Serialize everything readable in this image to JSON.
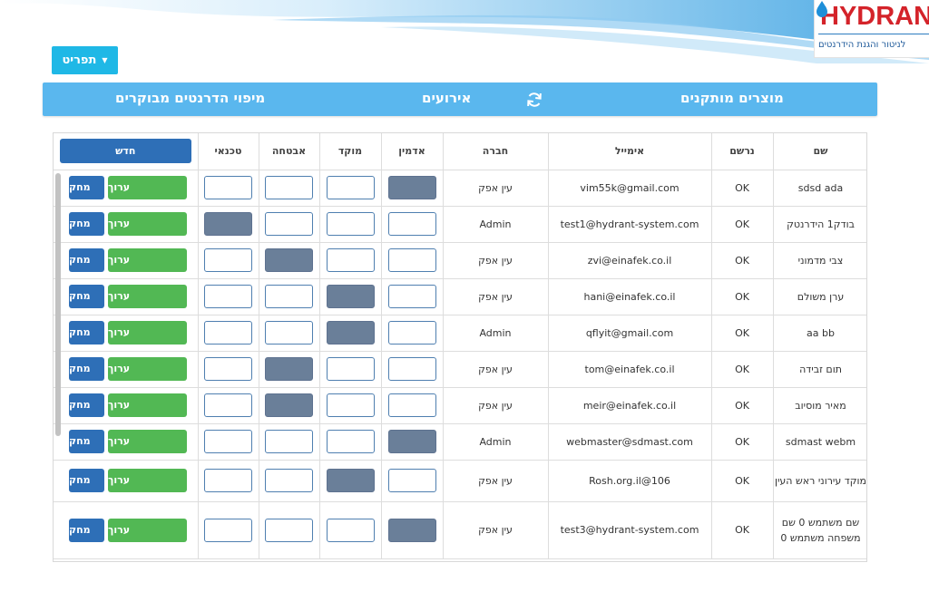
{
  "brand": {
    "logo_text": "HYDRANT",
    "tagline": "לניטור והגנת הידרנטים",
    "colors": {
      "logo_red": "#d4232a",
      "banner_blue": "#4aa9e4",
      "nav_blue": "#5ab7ee",
      "menu_cyan": "#1fb8e6"
    }
  },
  "menu_button": {
    "label": "תפריט",
    "icon": "caret-down-icon"
  },
  "nav": {
    "installed_products": "מוצרים מותקנים",
    "events": "אירועים",
    "refresh_icon": "refresh-icon",
    "hydrant_map": "מיפוי הדרנטים מבוקרים"
  },
  "table": {
    "headers": {
      "name": "שם",
      "registered": "נרשם",
      "email": "אימייל",
      "company": "חברה",
      "admin": "אדמין",
      "hub": "מוקד",
      "security": "אבטחה",
      "technician": "טכנאי",
      "new_button": "חדש"
    },
    "edit_label": "ערוך",
    "delete_label": "מחק",
    "rows": [
      {
        "name": "sdsd ada",
        "registered": "OK",
        "email": "vim55k@gmail.com",
        "company": "עין אפק",
        "admin": true,
        "hub": false,
        "security": false,
        "technician": false
      },
      {
        "name": "בודק1 הידרנטק",
        "registered": "OK",
        "email": "test1@hydrant-system.com",
        "company": "Admin",
        "admin": false,
        "hub": false,
        "security": false,
        "technician": true
      },
      {
        "name": "צבי מדמוני",
        "registered": "OK",
        "email": "zvi@einafek.co.il",
        "company": "עין אפק",
        "admin": false,
        "hub": false,
        "security": true,
        "technician": false
      },
      {
        "name": "ערן משולם",
        "registered": "OK",
        "email": "hani@einafek.co.il",
        "company": "עין אפק",
        "admin": false,
        "hub": true,
        "security": false,
        "technician": false
      },
      {
        "name": "aa bb",
        "registered": "OK",
        "email": "qflyit@gmail.com",
        "company": "Admin",
        "admin": false,
        "hub": true,
        "security": false,
        "technician": false
      },
      {
        "name": "תום זבידה",
        "registered": "OK",
        "email": "tom@einafek.co.il",
        "company": "עין אפק",
        "admin": false,
        "hub": false,
        "security": true,
        "technician": false
      },
      {
        "name": "מאיר מוסיוב",
        "registered": "OK",
        "email": "meir@einafek.co.il",
        "company": "עין אפק",
        "admin": false,
        "hub": false,
        "security": true,
        "technician": false
      },
      {
        "name": "sdmast webm",
        "registered": "OK",
        "email": "webmaster@sdmast.com",
        "company": "Admin",
        "admin": true,
        "hub": false,
        "security": false,
        "technician": false
      },
      {
        "name": "מוקד עירוני ראש העין",
        "registered": "OK",
        "email": "Rosh.org.il@106",
        "company": "עין אפק",
        "admin": false,
        "hub": true,
        "security": false,
        "technician": false
      },
      {
        "name": "שם משתמש 0 שם משפחה משתמש 0",
        "registered": "OK",
        "email": "test3@hydrant-system.com",
        "company": "עין אפק",
        "admin": true,
        "hub": false,
        "security": false,
        "technician": false
      }
    ]
  }
}
